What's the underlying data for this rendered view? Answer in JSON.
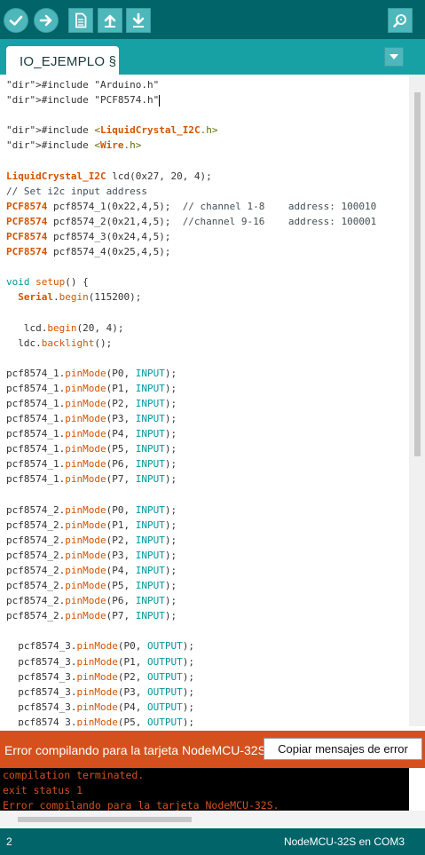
{
  "toolbar": {
    "buttons": [
      {
        "name": "verify",
        "icon": "checkmark-icon"
      },
      {
        "name": "upload",
        "icon": "arrow-right-icon"
      },
      {
        "name": "new",
        "icon": "document-icon"
      },
      {
        "name": "open",
        "icon": "arrow-up-icon"
      },
      {
        "name": "save",
        "icon": "arrow-down-icon"
      },
      {
        "name": "serial-monitor",
        "icon": "magnifier-icon"
      }
    ]
  },
  "tab": {
    "label": "IO_EJEMPLO §",
    "menu_icon": "triangle-down-icon"
  },
  "code_lines": [
    "#include \"Arduino.h\"",
    "#include \"PCF8574.h\"",
    "",
    "#include <LiquidCrystal_I2C.h>",
    "#include <Wire.h>",
    "",
    "LiquidCrystal_I2C lcd(0x27, 20, 4);",
    "// Set i2c input address",
    "PCF8574 pcf8574_1(0x22,4,5);  // channel 1-8    address: 100010",
    "PCF8574 pcf8574_2(0x21,4,5);  //channel 9-16    address: 100001",
    "PCF8574 pcf8574_3(0x24,4,5);",
    "PCF8574 pcf8574_4(0x25,4,5);",
    "",
    "void setup() {",
    "  Serial.begin(115200);",
    "",
    "   lcd.begin(20, 4);",
    "  ldc.backlight();",
    "",
    "pcf8574_1.pinMode(P0, INPUT);",
    "pcf8574_1.pinMode(P1, INPUT);",
    "pcf8574_1.pinMode(P2, INPUT);",
    "pcf8574_1.pinMode(P3, INPUT);",
    "pcf8574_1.pinMode(P4, INPUT);",
    "pcf8574_1.pinMode(P5, INPUT);",
    "pcf8574_1.pinMode(P6, INPUT);",
    "pcf8574_1.pinMode(P7, INPUT);",
    "",
    "pcf8574_2.pinMode(P0, INPUT);",
    "pcf8574_2.pinMode(P1, INPUT);",
    "pcf8574_2.pinMode(P2, INPUT);",
    "pcf8574_2.pinMode(P3, INPUT);",
    "pcf8574_2.pinMode(P4, INPUT);",
    "pcf8574_2.pinMode(P5, INPUT);",
    "pcf8574_2.pinMode(P6, INPUT);",
    "pcf8574_2.pinMode(P7, INPUT);",
    "",
    "  pcf8574_3.pinMode(P0, OUTPUT);",
    "  pcf8574_3.pinMode(P1, OUTPUT);",
    "  pcf8574_3.pinMode(P2, OUTPUT);",
    "  pcf8574_3.pinMode(P3, OUTPUT);",
    "  pcf8574_3.pinMode(P4, OUTPUT);",
    "  pcf8574_3.pinMode(P5, OUTPUT);"
  ],
  "error_bar": {
    "message": "Error compilando para la tarjeta NodeMCU-32S.",
    "copy_button": "Copiar mensajes de error"
  },
  "console": {
    "lines": [
      "compilation terminated.",
      "exit status 1",
      "Error compilando para la tarjeta NodeMCU-32S."
    ]
  },
  "status": {
    "line_number": "2",
    "board_port": "NodeMCU-32S en COM3"
  },
  "colors": {
    "toolbar": "#006468",
    "tabbar": "#17a1a5",
    "error": "#d4511e",
    "keyword": "#d35400",
    "constant": "#00979c"
  }
}
